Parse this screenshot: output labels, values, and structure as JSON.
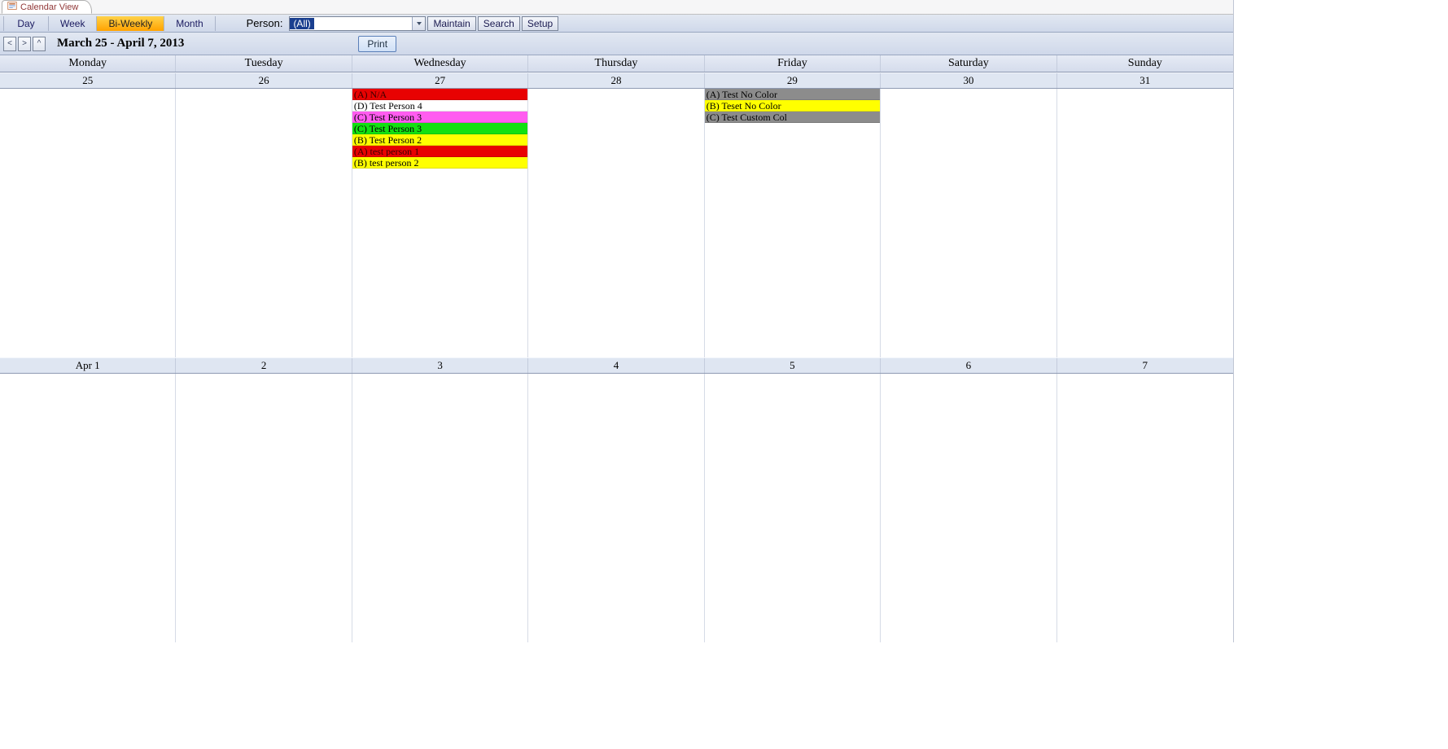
{
  "tab_title": "Calendar View",
  "toolbar": {
    "views": [
      "Day",
      "Week",
      "Bi-Weekly",
      "Month"
    ],
    "active_view_index": 2,
    "person_label": "Person:",
    "person_value": "(All)",
    "buttons": {
      "maintain": "Maintain",
      "search": "Search",
      "setup": "Setup"
    }
  },
  "nav": {
    "prev": "<",
    "next": ">",
    "up": "^",
    "date_range": "March 25 - April 7, 2013",
    "print": "Print"
  },
  "weekdays": [
    "Monday",
    "Tuesday",
    "Wednesday",
    "Thursday",
    "Friday",
    "Saturday",
    "Sunday"
  ],
  "week1_dates": [
    "25",
    "26",
    "27",
    "28",
    "29",
    "30",
    "31"
  ],
  "week2_dates": [
    "Apr 1",
    "2",
    "3",
    "4",
    "5",
    "6",
    "7"
  ],
  "colors": {
    "red": "#e80202",
    "red_text": "#3a0000",
    "white": "#ffffff",
    "magenta": "#ff5cf0",
    "green": "#12e012",
    "yellow": "#ffff00",
    "grey": "#8c8c8c"
  },
  "events_wed": [
    {
      "label": "(A) N/A",
      "bg": "red",
      "fg": "red_text"
    },
    {
      "label": "(D) Test Person 4",
      "bg": "white",
      "fg": "black"
    },
    {
      "label": "(C) Test Person 3",
      "bg": "magenta",
      "fg": "black"
    },
    {
      "label": "(C) Test Person 3",
      "bg": "green",
      "fg": "black"
    },
    {
      "label": "(B) Test Person 2",
      "bg": "yellow",
      "fg": "black"
    },
    {
      "label": "(A) test person 1",
      "bg": "red",
      "fg": "red_text"
    },
    {
      "label": "(B) test person 2",
      "bg": "yellow",
      "fg": "black"
    }
  ],
  "events_fri": [
    {
      "label": "(A) Test No Color",
      "bg": "grey",
      "fg": "black"
    },
    {
      "label": "(B) Teset No Color",
      "bg": "yellow",
      "fg": "black"
    },
    {
      "label": "(C) Test Custom Col",
      "bg": "grey",
      "fg": "black"
    }
  ]
}
